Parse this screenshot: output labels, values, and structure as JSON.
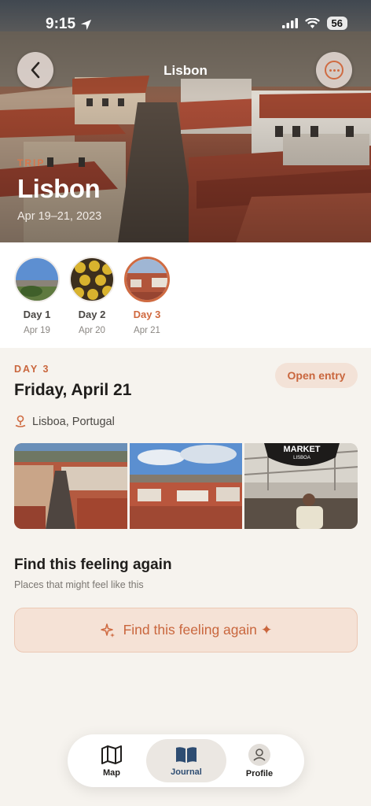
{
  "status": {
    "time": "9:15",
    "battery": "56"
  },
  "header": {
    "title": "Lisbon",
    "trip_label": "TRIP",
    "trip_title": "Lisbon",
    "trip_dates": "Apr 19–21, 2023"
  },
  "days": [
    {
      "label": "Day 1",
      "date": "Apr 19",
      "active": false
    },
    {
      "label": "Day 2",
      "date": "Apr 20",
      "active": false
    },
    {
      "label": "Day 3",
      "date": "Apr 21",
      "active": true
    }
  ],
  "detail": {
    "kicker": "DAY 3",
    "title": "Friday, April 21",
    "open_entry": "Open entry",
    "location": "Lisboa, Portugal",
    "photo_sign_text": "MARKET",
    "photo_sign_sub": "LISBOA"
  },
  "feeling": {
    "title": "Find this feeling again",
    "subtitle": "Places that might feel like this",
    "button_label": "Find this feeling again ✦"
  },
  "tabbar": {
    "map": "Map",
    "journal": "Journal",
    "profile": "Profile"
  },
  "colors": {
    "accent": "#cf6b42",
    "background": "#f6f3ee",
    "journal_active": "#2e4d72"
  }
}
